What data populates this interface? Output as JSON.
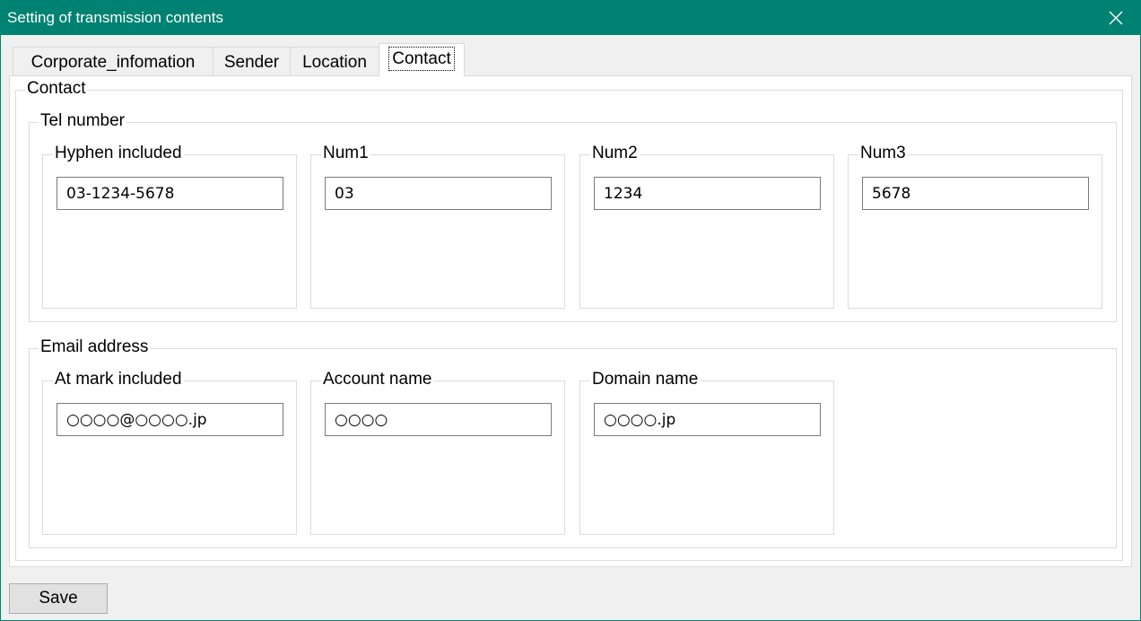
{
  "window": {
    "title": "Setting of transmission contents"
  },
  "tabs": [
    {
      "label": "Corporate_infomation"
    },
    {
      "label": "Sender"
    },
    {
      "label": "Location"
    },
    {
      "label": "Contact"
    }
  ],
  "active_tab": "Contact",
  "contact": {
    "group_label": "Contact",
    "tel": {
      "label": "Tel number",
      "hyphen": {
        "label": "Hyphen included",
        "value": "03-1234-5678"
      },
      "num1": {
        "label": "Num1",
        "value": "03"
      },
      "num2": {
        "label": "Num2",
        "value": "1234"
      },
      "num3": {
        "label": "Num3",
        "value": "5678"
      }
    },
    "email": {
      "label": "Email address",
      "atmark": {
        "label": "At mark included",
        "value": "○○○○@○○○○.jp"
      },
      "account": {
        "label": "Account name",
        "value": "○○○○"
      },
      "domain": {
        "label": "Domain name",
        "value": "○○○○.jp"
      }
    }
  },
  "buttons": {
    "save_label": "Save"
  },
  "icons": {
    "close": "close-icon"
  },
  "colors": {
    "titlebar": "#008272",
    "panel": "#ffffff",
    "background": "#f0f0f0"
  }
}
